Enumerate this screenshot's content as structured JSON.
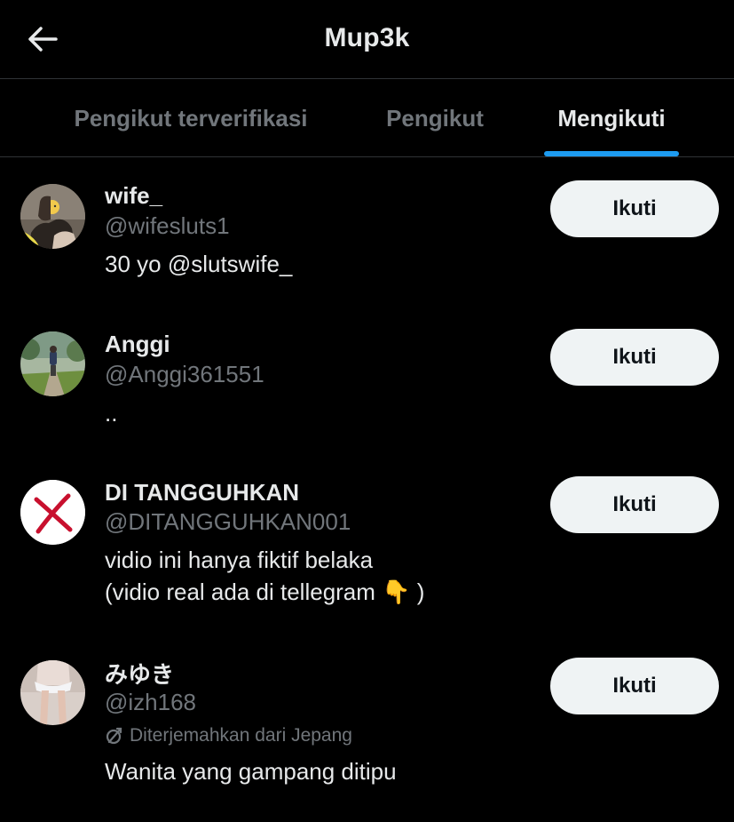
{
  "header": {
    "title": "Mup3k",
    "back_icon": "arrow-left-icon"
  },
  "tabs": [
    {
      "label": "Pengikut terverifikasi",
      "active": false
    },
    {
      "label": "Pengikut",
      "active": false
    },
    {
      "label": "Mengikuti",
      "active": true
    }
  ],
  "accent_color": "#1d9bf0",
  "users": [
    {
      "name": "wife_",
      "handle": "@wifesluts1",
      "bio": "30 yo @slutswife_",
      "button": "Ikuti",
      "avatar": "photo-avatar"
    },
    {
      "name": "Anggi",
      "handle": "@Anggi361551",
      "bio": "..",
      "button": "Ikuti",
      "avatar": "photo-avatar"
    },
    {
      "name": "DI TANGGUHKAN",
      "handle": "@DITANGGUHKAN001",
      "bio": "vidio ini hanya fiktif belaka\n(vidio real ada di tellegram 👇 )",
      "button": "Ikuti",
      "avatar": "red-x-avatar"
    },
    {
      "name": "みゆき",
      "handle": "@izh168",
      "translated_note": "Diterjemahkan dari Jepang",
      "bio": "Wanita yang gampang ditipu",
      "button": "Ikuti",
      "avatar": "photo-avatar"
    }
  ]
}
